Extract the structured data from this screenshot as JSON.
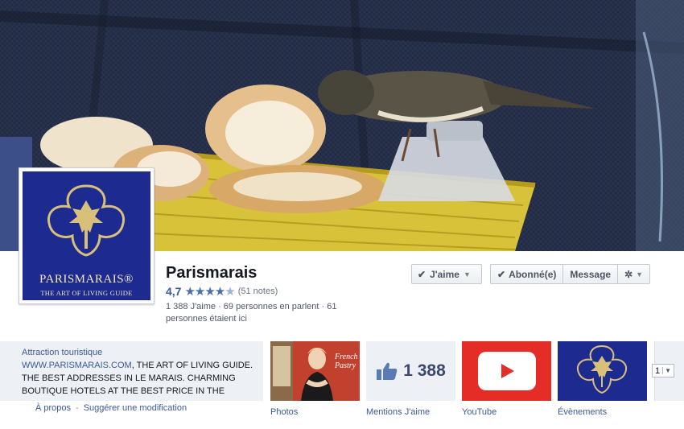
{
  "page": {
    "title": "Parismarais",
    "rating_value": "4,7",
    "rating_count": "(51 notes)",
    "stats": "1 388 J'aime · 69 personnes en parlent · 61 personnes étaient ici"
  },
  "profile": {
    "brand_name": "PARISMARAIS®",
    "brand_tagline": "THE ART OF LIVING GUIDE"
  },
  "actions": {
    "like_label": "J'aime",
    "subscribed_label": "Abonné(e)",
    "message_label": "Message"
  },
  "about": {
    "category": "Attraction touristique",
    "link": "WWW.PARISMARAIS.COM",
    "description": ", THE ART OF LIVING GUIDE. THE BEST ADDRESSES IN LE MARAIS. CHARMING BOUTIQUE HOTELS AT THE BEST PRICE IN THE",
    "about_link": "À propos",
    "suggest_link": "Suggérer une modification"
  },
  "apps": {
    "photos_label": "Photos",
    "photos_book_title": "French Pastry",
    "likes_label": "Mentions J'aime",
    "likes_count": "1 388",
    "youtube_label": "YouTube",
    "events_label": "Évènements",
    "more_value": "1"
  },
  "colors": {
    "brand_blue": "#1d2a8f",
    "link_blue": "#3b5998",
    "youtube_red": "#e52d27"
  },
  "icons": [
    "check-icon",
    "chevron-down-icon",
    "gear-icon",
    "thumbs-up-icon",
    "play-icon",
    "star-icon"
  ]
}
